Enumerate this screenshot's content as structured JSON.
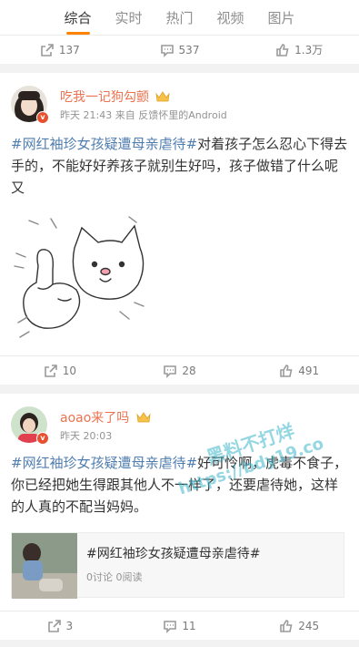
{
  "tabs": [
    {
      "label": "综合",
      "active": true
    },
    {
      "label": "实时"
    },
    {
      "label": "热门"
    },
    {
      "label": "视频"
    },
    {
      "label": "图片"
    }
  ],
  "post0": {
    "repost": "137",
    "comment": "537",
    "like": "1.3万"
  },
  "post1": {
    "user": "吃我一记狗勾颤",
    "time": "昨天 21:43",
    "source": "来自 反馈怀里的Android",
    "hashtag": "#网红袖珍女孩疑遭母亲虐待#",
    "body": "对着孩子怎么忍心下得去手的，不能好好养孩子就别生好吗，孩子做错了什么呢又",
    "repost": "10",
    "comment": "28",
    "like": "491"
  },
  "post2": {
    "user": "aoao来了吗",
    "time": "昨天 20:03",
    "hashtag": "#网红袖珍女孩疑遭母亲虐待#",
    "body": "好可怜啊，虎毒不食子，你已经把她生得跟其他人不一样了，还要虐待她，这样的人真的不配当妈妈。",
    "card_title": "#网红袖珍女孩疑遭母亲虐待#",
    "card_sub": "0讨论 0阅读",
    "repost": "3",
    "comment": "11",
    "like": "245"
  },
  "watermark": {
    "line1": "黑料不打烊",
    "line2": "https://bdy19.co"
  },
  "icons": [
    "repost-icon",
    "comment-icon",
    "like-icon",
    "crown-icon",
    "verified-badge-icon"
  ]
}
